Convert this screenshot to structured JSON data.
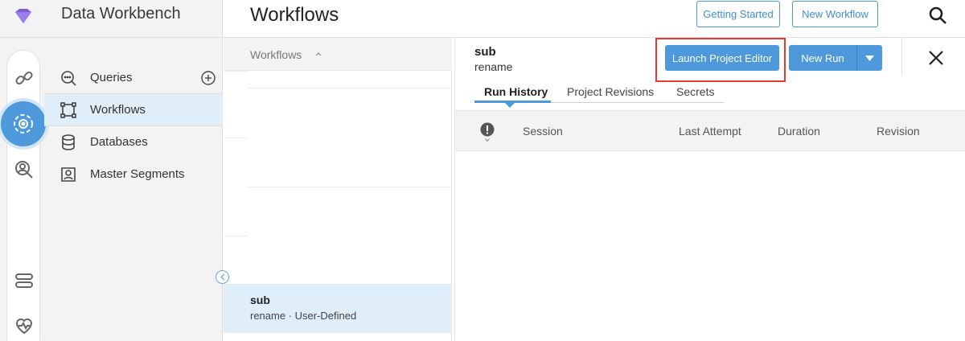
{
  "app": {
    "title": "Data Workbench",
    "logo_icon": "gem-icon",
    "accent_color": "#4d99db",
    "highlight_color": "#e03c31"
  },
  "rail": {
    "icons": [
      "link-icon",
      "workflow-gear-icon",
      "user-search-icon",
      "toggle-icon",
      "heart-icon"
    ],
    "active": "workflow-gear-icon"
  },
  "sidebar": {
    "items": [
      {
        "label": "Queries",
        "icon": "query-search-icon",
        "has_add": true
      },
      {
        "label": "Workflows",
        "icon": "workflow-icon",
        "active": true
      },
      {
        "label": "Databases",
        "icon": "database-icon"
      },
      {
        "label": "Master Segments",
        "icon": "segment-icon"
      }
    ]
  },
  "header": {
    "title": "Workflows",
    "getting_started": "Getting Started",
    "new_workflow": "New Workflow"
  },
  "list": {
    "header": "Workflows",
    "selected": {
      "title": "sub",
      "subtitle": "rename · User-Defined"
    }
  },
  "detail": {
    "title": "sub",
    "subtitle": "rename",
    "launch_editor": "Launch Project Editor",
    "new_run": "New Run",
    "tabs": [
      "Run History",
      "Project Revisions",
      "Secrets"
    ],
    "active_tab": "Run History",
    "columns": [
      "Session",
      "Last Attempt",
      "Duration",
      "Revision"
    ]
  }
}
